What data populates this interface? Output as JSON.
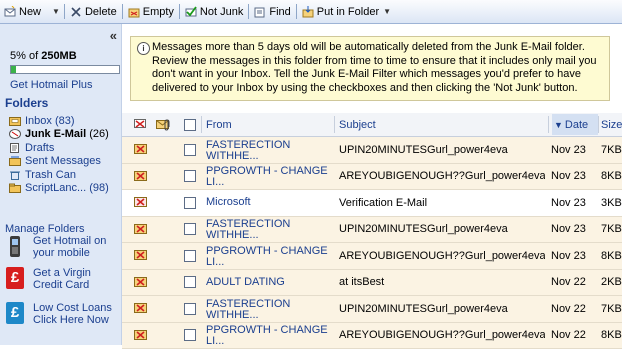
{
  "toolbar": {
    "new_label": "New",
    "delete_label": "Delete",
    "empty_label": "Empty",
    "notjunk_label": "Not Junk",
    "find_label": "Find",
    "putinfolder_label": "Put in Folder"
  },
  "sidebar": {
    "quota_pct": "5% of",
    "quota_size": "250MB",
    "quota_fraction": 0.05,
    "plus_link": "Get Hotmail Plus",
    "folders_heading": "Folders",
    "folders": [
      {
        "name": "Inbox (83)",
        "icon": "inbox-icon",
        "active": false
      },
      {
        "name": "Junk E-Mail",
        "count": "(26)",
        "icon": "junk-folder-icon",
        "active": true
      },
      {
        "name": "Drafts",
        "icon": "drafts-icon",
        "active": false
      },
      {
        "name": "Sent Messages",
        "icon": "sent-icon",
        "active": false
      },
      {
        "name": "Trash Can",
        "icon": "trash-icon",
        "active": false
      },
      {
        "name": "ScriptLanc... (98)",
        "icon": "folder-icon",
        "active": false
      }
    ],
    "manage_link": "Manage Folders",
    "promos": [
      {
        "text": "Get Hotmail on your mobile",
        "icon": "mobile-phone-icon"
      },
      {
        "text": "Get a Virgin Credit Card",
        "icon": "pound-icon"
      },
      {
        "text": "Low Cost Loans Click Here Now",
        "icon": "pound-icon"
      }
    ]
  },
  "notice": {
    "text": "Messages more than 5 days old will be automatically deleted from the Junk E-Mail folder. Review the messages in this folder from time to time to ensure that it includes only mail you don't want in your Inbox. Tell the Junk E-Mail Filter which messages you'd prefer to have delivered to your Inbox by using the checkboxes and then clicking the 'Not Junk' button."
  },
  "grid": {
    "columns": {
      "from": "From",
      "subject": "Subject",
      "date": "Date",
      "size": "Size"
    },
    "rows": [
      {
        "from": "FASTERECTION WITHHE...",
        "subject": "UPIN20MINUTESGurl_power4eva",
        "date": "Nov 23",
        "size": "7KB",
        "read": false
      },
      {
        "from": "PPGROWTH - CHANGE LI...",
        "subject": "AREYOUBIGENOUGH??Gurl_power4eva",
        "date": "Nov 23",
        "size": "8KB",
        "read": false
      },
      {
        "from": "Microsoft",
        "subject": "Verification E-Mail",
        "date": "Nov 23",
        "size": "3KB",
        "read": true
      },
      {
        "from": "FASTERECTION WITHHE...",
        "subject": "UPIN20MINUTESGurl_power4eva",
        "date": "Nov 23",
        "size": "7KB",
        "read": false
      },
      {
        "from": "PPGROWTH - CHANGE LI...",
        "subject": "AREYOUBIGENOUGH??Gurl_power4eva",
        "date": "Nov 23",
        "size": "8KB",
        "read": false
      },
      {
        "from": "ADULT DATING",
        "subject": "at itsBest",
        "date": "Nov 22",
        "size": "2KB",
        "read": false
      },
      {
        "from": "FASTERECTION WITHHE...",
        "subject": "UPIN20MINUTESGurl_power4eva",
        "date": "Nov 22",
        "size": "7KB",
        "read": false
      },
      {
        "from": "PPGROWTH - CHANGE LI...",
        "subject": "AREYOUBIGENOUGH??Gurl_power4eva",
        "date": "Nov 22",
        "size": "8KB",
        "read": false
      }
    ]
  }
}
